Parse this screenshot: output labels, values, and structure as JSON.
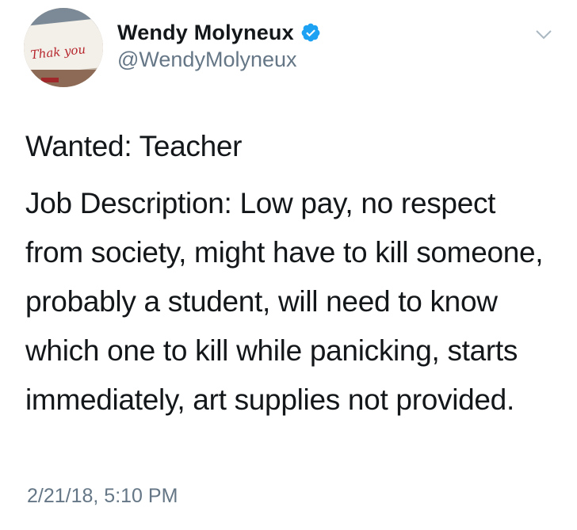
{
  "tweet": {
    "author": {
      "display_name": "Wendy Molyneux",
      "handle": "@WendyMolyneux",
      "verified_icon": "verified-badge-icon",
      "avatar_text": "Thak you"
    },
    "menu_icon": "chevron-down-icon",
    "text": {
      "line_1": "Wanted: Teacher",
      "line_2": "Job Description: Low pay, no respect from society, might have to kill someone, probably a student, will need to know which one to kill while panicking, starts immediately, art supplies not provided."
    },
    "timestamp": "2/21/18, 5:10 PM"
  },
  "colors": {
    "text_primary": "#14171a",
    "text_secondary": "#657786",
    "verified_blue": "#1da1f2",
    "background": "#ffffff"
  }
}
